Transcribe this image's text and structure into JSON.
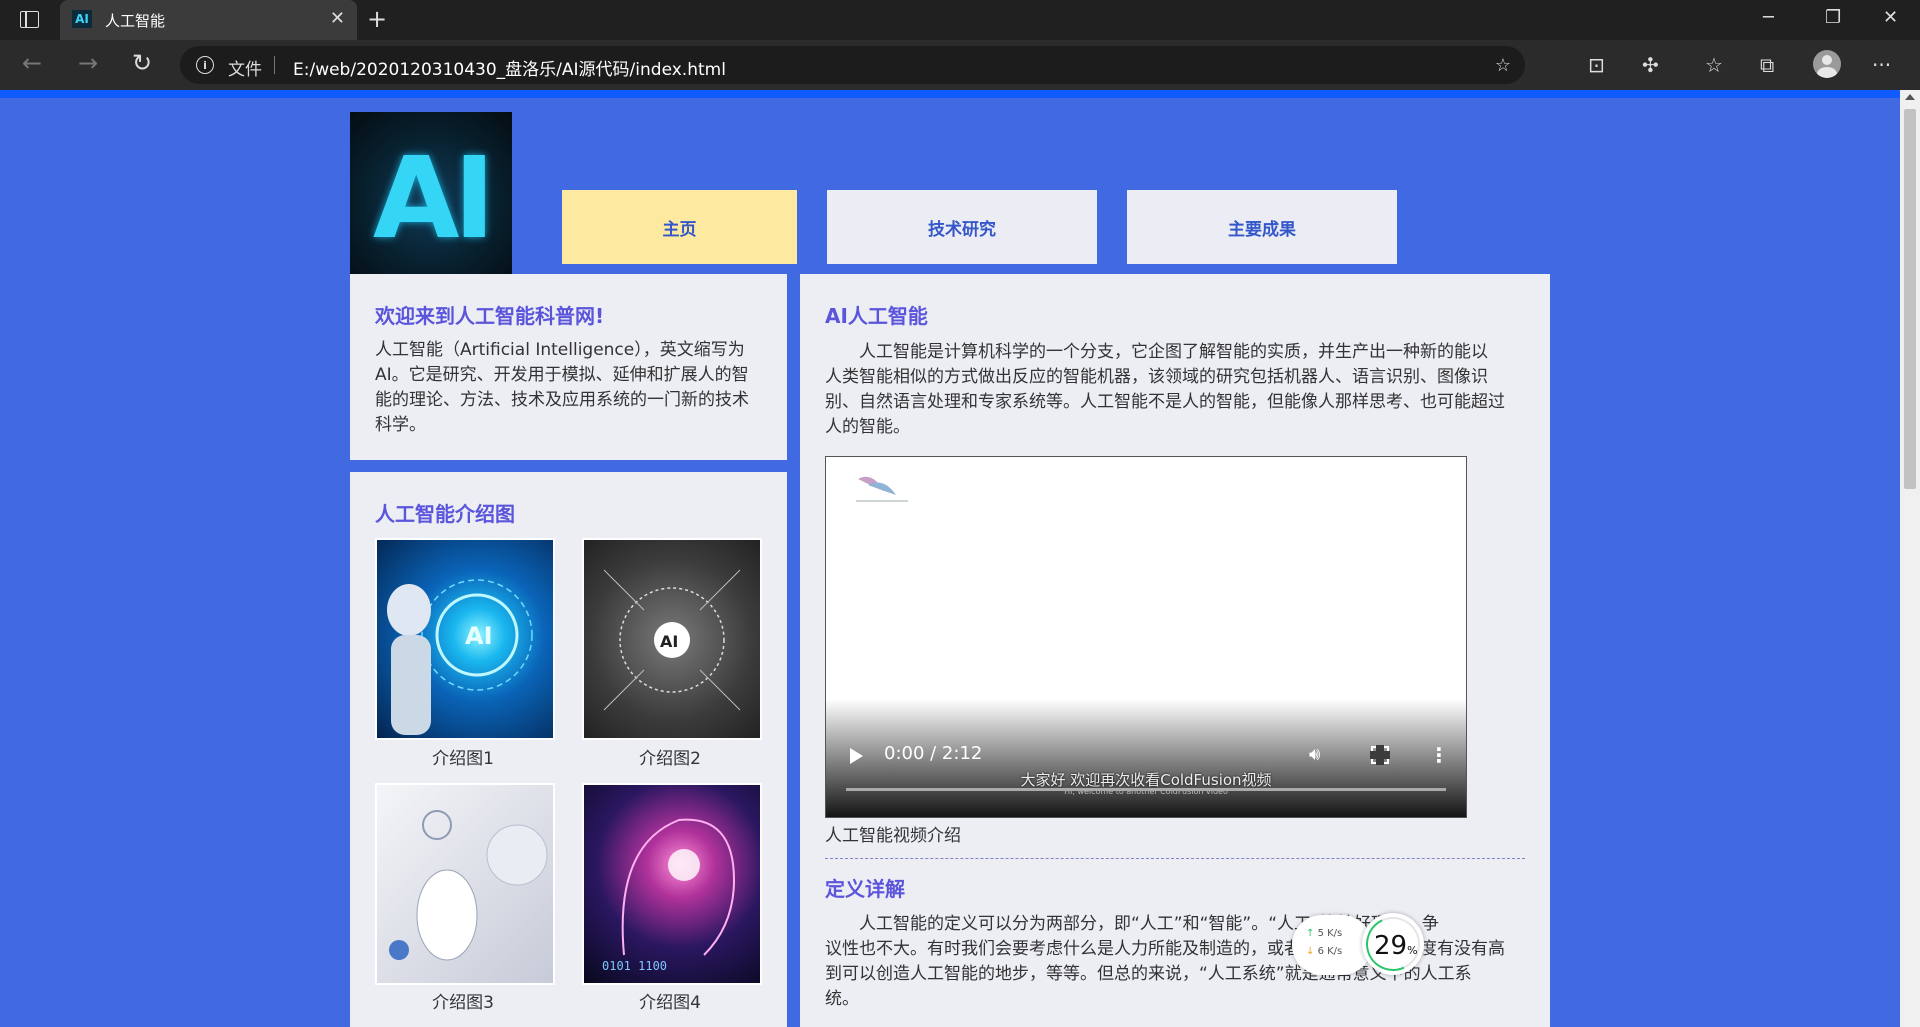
{
  "browser": {
    "tab_title": "人工智能",
    "tab_favicon_text": "AI",
    "file_label": "文件",
    "url": "E:/web/2020120310430_盘洛乐/AI源代码/index.html"
  },
  "page": {
    "logo_text": "AI",
    "nav": [
      "主页",
      "技术研究",
      "主要成果"
    ],
    "welcome": {
      "title": "欢迎来到人工智能科普网!",
      "lines": [
        "人工智能（Artificial Intelligence），英文缩写为",
        "AI。它是研究、开发用于模拟、延伸和扩展人的智",
        "能的理论、方法、技术及应用系统的一门新的技术",
        "科学。"
      ]
    },
    "gallery": {
      "title": "人工智能介绍图",
      "captions": [
        "介绍图1",
        "介绍图2",
        "介绍图3",
        "介绍图4"
      ]
    },
    "ai_section": {
      "title": "AI人工智能",
      "lines": [
        "　　人工智能是计算机科学的一个分支，它企图了解智能的实质，并生产出一种新的能以",
        "人类智能相似的方式做出反应的智能机器，该领域的研究包括机器人、语言识别、图像识",
        "别、自然语言处理和专家系统等。人工智能不是人的智能，但能像人那样思考、也可能超过",
        "人的智能。"
      ]
    },
    "video": {
      "time": "0:00 / 2:12",
      "subtitle": "大家好 欢迎再次收看ColdFusion视频",
      "subtitle_en": "Hi, welcome to another ColdFusion video",
      "caption": "人工智能视频介绍"
    },
    "definition": {
      "title": "定义详解",
      "lines": [
        "　　人工智能的定义可以分为两部分，即“人工”和“智能”。“人工”比较好理解，争",
        "议性也不大。有时我们会要考虑什么是人力所能及制造的，或者人自身的智能程度有没有高",
        "到可以创造人工智能的地步，等等。但总的来说，“人工系统”就是通常意义下的人工系",
        "统。"
      ]
    }
  },
  "speed_widget": {
    "up": "5 K/s",
    "down": "6 K/s",
    "percent": "29",
    "percent_sign": "%"
  }
}
